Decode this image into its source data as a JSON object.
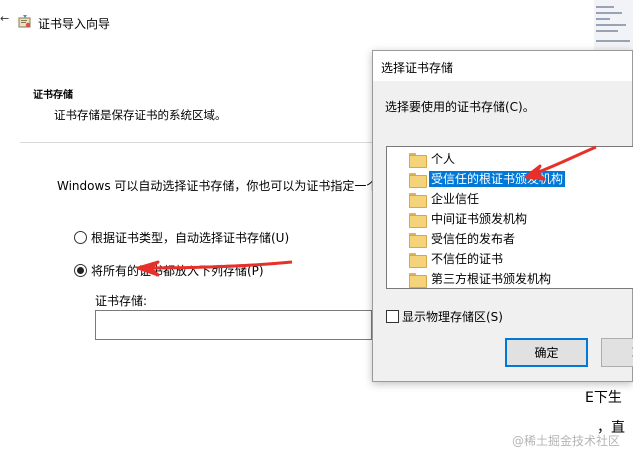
{
  "wizard": {
    "title": "证书导入向导",
    "section_heading": "证书存储",
    "section_description": "证书存储是保存证书的系统区域。",
    "intro": "Windows 可以自动选择证书存储，你也可以为证书指定一个位置。",
    "radio_auto_label": "根据证书类型，自动选择证书存储(U)",
    "radio_manual_label": "将所有的证书都放入下列存储(P)",
    "radio_selected": "manual",
    "store_label": "证书存储:",
    "store_value": ""
  },
  "dialog": {
    "title": "选择证书存储",
    "prompt": "选择要使用的证书存储(C)。",
    "stores": [
      {
        "label": "个人",
        "selected": false
      },
      {
        "label": "受信任的根证书颁发机构",
        "selected": true
      },
      {
        "label": "企业信任",
        "selected": false
      },
      {
        "label": "中间证书颁发机构",
        "selected": false
      },
      {
        "label": "受信任的发布者",
        "selected": false
      },
      {
        "label": "不信任的证书",
        "selected": false
      },
      {
        "label": "第三方根证书颁发机构",
        "selected": false
      }
    ],
    "show_physical_label": "显示物理存储区(S)",
    "show_physical_checked": false,
    "ok_label": "确定",
    "cancel_label": "取"
  },
  "background_peek": {
    "text_1": "E下生",
    "text_2": "，直",
    "watermark": "@稀土掘金技术社区"
  },
  "colors": {
    "selection": "#0078d7",
    "annotation_arrow": "#e8302a",
    "folder": "#f5d37a"
  },
  "icons": {
    "wizard": "certificate-wizard-icon",
    "back": "back-arrow-icon",
    "folder": "folder-icon"
  }
}
